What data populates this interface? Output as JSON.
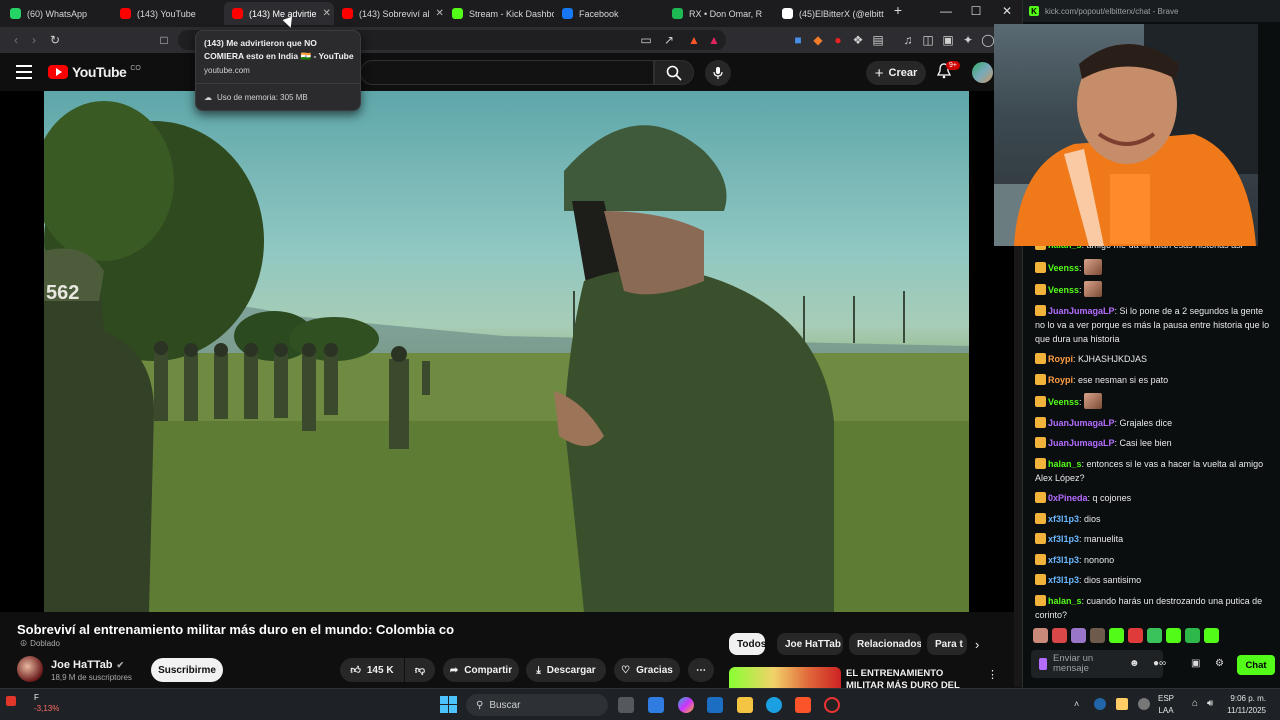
{
  "browser": {
    "tabs": [
      {
        "label": "(60) WhatsApp",
        "color": "#25d366"
      },
      {
        "label": "(143) YouTube",
        "color": "#ff0000"
      },
      {
        "label": "(143) Me advirtie",
        "color": "#ff0000",
        "active": true
      },
      {
        "label": "(143) Sobreviví al",
        "color": "#ff0000"
      },
      {
        "label": "Stream - Kick Dashbo",
        "color": "#53fc18"
      },
      {
        "label": "Facebook",
        "color": "#1877f2"
      },
      {
        "label": "RX • Don Omar, R",
        "color": "#1db954"
      },
      {
        "label": "(45)ElBitterX (@elbitte",
        "color": "#ffffff"
      }
    ],
    "new_tab": "+",
    "tooltip": {
      "title": "(143) Me advirtieron que NO COMIERA esto en India 🇮🇳 - YouTube",
      "url": "youtube.com",
      "memory": "Uso de memoria: 305 MB"
    }
  },
  "youtube": {
    "logo_text": "YouTube",
    "logo_sup": "CO",
    "create_label": "Crear",
    "notif_count": "9+",
    "video_title": "Sobreviví al entrenamiento militar más duro en el mundo: Colombia co",
    "dubbed_label": "Doblado",
    "channel_name": "Joe HaTTab",
    "channel_subs": "18,9 M de suscriptores",
    "subscribe_label": "Suscribirme",
    "like_count": "145 K",
    "share_label": "Compartir",
    "download_label": "Descargar",
    "thanks_label": "Gracias",
    "chips": [
      "Todos",
      "Joe HaTTab",
      "Relacionados",
      "Para t"
    ],
    "related_title": "EL ENTRENAMIENTO MILITAR MÁS DURO DEL MUNDO",
    "scene_tag": "562"
  },
  "kick": {
    "window_title": "kick.com/popout/elbitterx/chat - Brave",
    "messages": [
      {
        "user": "halan_s",
        "color": "#53fc18",
        "text": "amigo me da un afan esas historias asi"
      },
      {
        "user": "Veenss",
        "color": "#53fc18",
        "text": "",
        "emote": true
      },
      {
        "user": "Veenss",
        "color": "#53fc18",
        "text": "",
        "emote": true
      },
      {
        "user": "JuanJumagaLP",
        "color": "#b46cff",
        "text": "Si lo pone de a 2 segundos la gente no lo va a ver porque es más la pausa entre historia que lo que dura una historia"
      },
      {
        "user": "Roypi",
        "color": "#ff9f43",
        "text": "KJHASHJKDJAS"
      },
      {
        "user": "Roypi",
        "color": "#ff9f43",
        "text": "ese nesman si es pato"
      },
      {
        "user": "Veenss",
        "color": "#53fc18",
        "text": "",
        "emote": true
      },
      {
        "user": "JuanJumagaLP",
        "color": "#b46cff",
        "text": "Grajales dice"
      },
      {
        "user": "JuanJumagaLP",
        "color": "#b46cff",
        "text": "Casi lee bien"
      },
      {
        "user": "halan_s",
        "color": "#53fc18",
        "text": "entonces si le vas a hacer la vuelta al amigo Alex López?"
      },
      {
        "user": "0xPineda",
        "color": "#b46cff",
        "text": "q cojones"
      },
      {
        "user": "xf3l1p3",
        "color": "#6ab7ff",
        "text": "dios"
      },
      {
        "user": "xf3l1p3",
        "color": "#6ab7ff",
        "text": "manuelita"
      },
      {
        "user": "xf3l1p3",
        "color": "#6ab7ff",
        "text": "nonono"
      },
      {
        "user": "xf3l1p3",
        "color": "#6ab7ff",
        "text": "dios santisimo"
      },
      {
        "user": "halan_s",
        "color": "#53fc18",
        "text": "cuando harás un destrozando una putica de corinto?"
      }
    ],
    "input_placeholder": "Enviar un mensaje",
    "chat_button": "Chat"
  },
  "taskbar": {
    "stock_label": "F",
    "stock_change": "-3,13%",
    "search_placeholder": "Buscar",
    "lang": "ESP",
    "lang_sub": "LAA",
    "time": "9:06 p. m.",
    "date": "11/11/2025"
  }
}
